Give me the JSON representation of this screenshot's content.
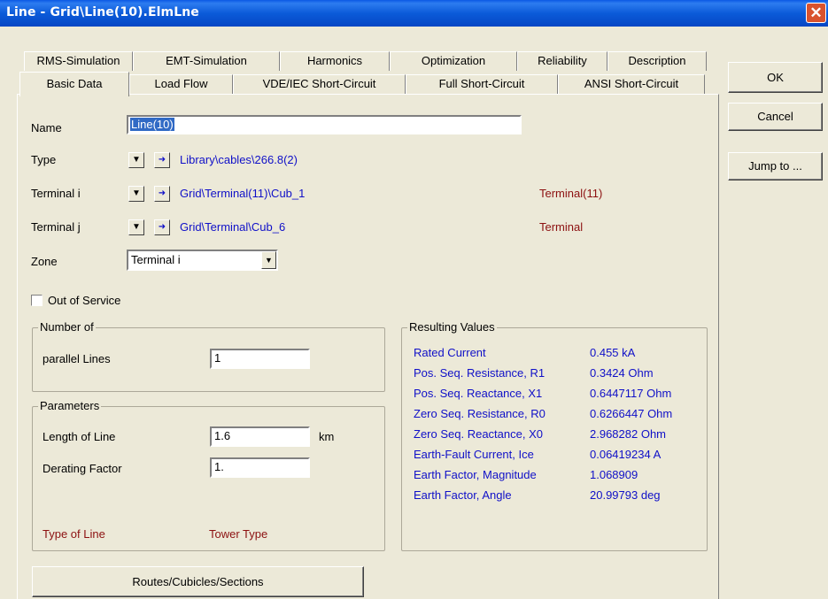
{
  "window": {
    "title": "Line - Grid\\Line(10).ElmLne",
    "close_glyph": "✕"
  },
  "tabs": {
    "row1": [
      "RMS-Simulation",
      "EMT-Simulation",
      "Harmonics",
      "Optimization",
      "Reliability",
      "Description"
    ],
    "row2": [
      "Basic Data",
      "Load Flow",
      "VDE/IEC Short-Circuit",
      "Full Short-Circuit",
      "ANSI Short-Circuit"
    ],
    "active": "Basic Data"
  },
  "buttons": {
    "ok": "OK",
    "cancel": "Cancel",
    "jump_to": "Jump to ...",
    "routes": "Routes/Cubicles/Sections"
  },
  "fields": {
    "name_label": "Name",
    "name_value": "Line(10)",
    "type_label": "Type",
    "type_value": "Library\\cables\\266.8(2)",
    "terminal_i_label": "Terminal i",
    "terminal_i_value": "Grid\\Terminal(11)\\Cub_1",
    "terminal_i_ref": "Terminal(11)",
    "terminal_j_label": "Terminal j",
    "terminal_j_value": "Grid\\Terminal\\Cub_6",
    "terminal_j_ref": "Terminal",
    "zone_label": "Zone",
    "zone_value": "Terminal i",
    "out_of_service_label": "Out of Service",
    "out_of_service_checked": false
  },
  "number_of": {
    "title": "Number of",
    "parallel_label": "parallel Lines",
    "parallel_value": "1"
  },
  "parameters": {
    "title": "Parameters",
    "length_label": "Length of Line",
    "length_value": "1.6",
    "length_unit": "km",
    "derating_label": "Derating Factor",
    "derating_value": "1.",
    "type_of_line": "Type of Line",
    "tower_type": "Tower Type"
  },
  "results": {
    "title": "Resulting Values",
    "rows": [
      {
        "label": "Rated Current",
        "value": "0.455 kA"
      },
      {
        "label": "Pos. Seq. Resistance, R1",
        "value": "0.3424 Ohm"
      },
      {
        "label": "Pos. Seq. Reactance, X1",
        "value": "0.6447117 Ohm"
      },
      {
        "label": "Zero Seq. Resistance, R0",
        "value": "0.6266447 Ohm"
      },
      {
        "label": "Zero Seq. Reactance, X0",
        "value": "2.968282 Ohm"
      },
      {
        "label": "Earth-Fault Current, Ice",
        "value": "0.06419234 A"
      },
      {
        "label": "Earth Factor, Magnitude",
        "value": "1.068909"
      },
      {
        "label": "Earth Factor, Angle",
        "value": "20.99793 deg"
      }
    ]
  }
}
